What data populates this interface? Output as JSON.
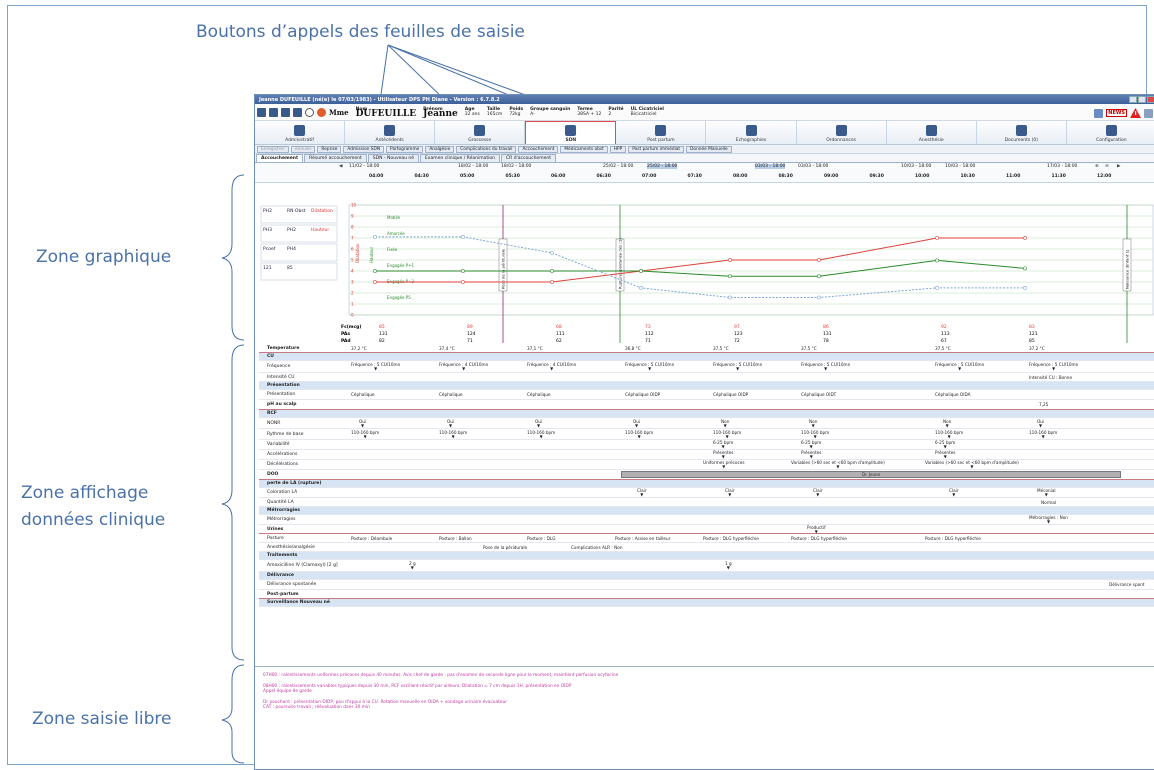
{
  "annotations": {
    "top": "Boutons d’appels des feuilles de saisie",
    "graph": "Zone graphique",
    "clinical_1": "Zone affichage",
    "clinical_2": "données clinique",
    "free": "Zone saisie libre"
  },
  "window": {
    "title": "Jeanne DUFEUILLE (né(e) le 07/03/1983) - Utilisateur DPS PH Diane - Version : 6.7.8.2"
  },
  "patient": {
    "mode_label": "Mme",
    "nom_label": "Nom",
    "nom": "DUFEUILLE",
    "prenom_label": "Prénom",
    "prenom": "Jeanne",
    "age_label": "Age",
    "age": "32 ans",
    "taille_label": "Taille",
    "taille": "165cm",
    "poids_label": "Poids",
    "poids": "72kg",
    "groupe_label": "Groupe sanguin",
    "groupe": "A-",
    "terme_label": "Terme",
    "terme": "38SA + 12",
    "parite_label": "Parité",
    "parite": "2",
    "ul_label": "UL Cicatriciel",
    "ul": "Bicicatriciel",
    "news_badge": "NEWS"
  },
  "nav_tabs": [
    {
      "label": "Administratif"
    },
    {
      "label": "Antécédents"
    },
    {
      "label": "Grossesse"
    },
    {
      "label": "SDN"
    },
    {
      "label": "Post partum"
    },
    {
      "label": "Echographies"
    },
    {
      "label": "Ordonnances"
    },
    {
      "label": "Anesthésie"
    },
    {
      "label": "Documents (0)"
    },
    {
      "label": "Configuration"
    }
  ],
  "actions": [
    "Enregistrer",
    "Annuler",
    "Reprise",
    "Admission SDN",
    "Partogramme",
    "Analgésie",
    "Complications du travail",
    "Accouchement",
    "Médicaments obst",
    "HPP",
    "Post partum immédiat",
    "Donnée Manuelle"
  ],
  "subtabs": [
    "Accouchement",
    "Résumé accouchement",
    "SDN - Nouveau né",
    "Examen clinique / Réanimation",
    "CR d'accouchement"
  ],
  "timeline": {
    "dates": [
      "11/02 - 18:00",
      "18/02 - 18:00",
      "18/02 - 18:00",
      "25/02 - 18:00",
      "25/02 - 18:00",
      "03/03 - 18:00",
      "03/03 - 18:00",
      "10/03 - 18:00",
      "10/03 - 18:00",
      "17/03 - 18:00"
    ],
    "hours": [
      "04:00",
      "04:30",
      "05:00",
      "05:30",
      "06:00",
      "06:30",
      "07:00",
      "07:30",
      "08:00",
      "08:30",
      "09:00",
      "09:30",
      "10:00",
      "10:30",
      "11:00",
      "11:30",
      "12:00"
    ]
  },
  "graph": {
    "left_boxes": [
      [
        "PH2",
        "RN Obst",
        "Dilatation"
      ],
      [
        "PH3",
        "PH2",
        "Hauteur"
      ],
      [
        "Pcoef",
        "PH4"
      ],
      [
        "121",
        "85"
      ]
    ],
    "levels": [
      "Mobile",
      "Amorcée",
      "Fixée",
      "Engagée P+1",
      "Engagée P+3",
      "Engagée P5"
    ],
    "y_axis": [
      "10",
      "9",
      "8",
      "7",
      "6",
      "5",
      "4",
      "3",
      "2",
      "1",
      "0"
    ],
    "axis_titles": [
      "Dilatation",
      "Hauteur"
    ],
    "events": [
      "Pose de la péridurale",
      "Rupture spontanée des (1)",
      "Naissance (Enfant 1)"
    ],
    "fc_label": "Fc(mcg)",
    "pas_label": "PAs",
    "pad_label": "PAd",
    "fc_values": [
      "85",
      "89",
      "68",
      "73",
      "97",
      "86",
      "92",
      "83"
    ],
    "pas_values": [
      "131",
      "124",
      "111",
      "112",
      "123",
      "131",
      "113",
      "121"
    ],
    "pad_values": [
      "82",
      "71",
      "62",
      "71",
      "72",
      "78",
      "67",
      "85"
    ]
  },
  "clinical": {
    "temperature_label": "Temperature",
    "temperature": [
      "37,2 °C",
      "37,4 °C",
      "37,1 °C",
      "36,8 °C",
      "37,5 °C",
      "37,5 °C",
      "37,5 °C",
      "37,2 °C"
    ],
    "cu_label": "CU",
    "frequence_label": "Fréquence",
    "frequence": [
      "Fréquence : 5 CU/10mn",
      "Fréquence : 4 CU/10mn",
      "Fréquence : 4 CU/10mn",
      "Fréquence : 5 CU/10mn",
      "Fréquence : 5 CU/10mn",
      "Fréquence : 5 CU/10mn",
      "Fréquence : 5 CU/10mn",
      "Fréquence : 5 CU/10mn"
    ],
    "intensite_label": "Intensité CU",
    "intensite": "Intensité CU : Bonne",
    "presentation_section": "Présentation",
    "presentation_label": "Présentation",
    "presentation": [
      "Céphalique",
      "Céphalique",
      "Céphalique",
      "Céphalique OIDP",
      "Céphalique OIDP",
      "Céphalique OIDT",
      "Céphalique OIDA"
    ],
    "ph_label": "pH au scalp",
    "ph_value": "7,25",
    "rcf_label": "RCF",
    "nonr_label": "NONR",
    "nonr": [
      "Oui",
      "Oui",
      "Oui",
      "Oui",
      "Non",
      "Non",
      "Non",
      "Oui"
    ],
    "rythme_label": "Rythme de base",
    "rythme": [
      "110-160 bpm",
      "110-160 bpm",
      "110-160 bpm",
      "110-160 bpm",
      "110-160 bpm",
      "110-160 bpm",
      "110-160 bpm",
      "110-160 bpm"
    ],
    "variabilite_label": "Variabilité",
    "variabilite": [
      "6-25 bpm",
      "6-25 bpm",
      "6-25 bpm"
    ],
    "accelerations_label": "Accélérations",
    "accelerations": [
      "Présentes",
      "Présentes",
      "Présentes"
    ],
    "decelerations_label": "Décélérations",
    "decelerations": [
      "Uniformes précoces",
      "Variables (>60 sec et <60 bpm d'amplitude)",
      "Variables (>60 sec et <60 bpm d'amplitude)"
    ],
    "doo_label": "DOO",
    "doo_bar": "Dr. Jeune",
    "perte_label": "perte de LA (rupture)",
    "coloration_label": "Coloration LA",
    "coloration": [
      "Clair",
      "Clair",
      "Clair",
      "Clair",
      "Méconial"
    ],
    "quantite_label": "Quantité LA",
    "quantite": "Normal",
    "metro_section": "Métrorragies",
    "metro_label": "Métrorragies",
    "metro": "Métrorragies : Non",
    "urines_label": "Urines",
    "urines": "Productif",
    "posture_label": "Posture",
    "posture": [
      "Posture : Déambule",
      "Posture : Ballon",
      "Posture : DLG",
      "Posture : Assise en tailleur",
      "Posture : DLG hyperfléchie",
      "Posture : DLG hyperfléchie",
      "Posture : DLG hyperfléchie"
    ],
    "anesth_label": "Anesthésie/analgésie",
    "anesth": [
      "Pose de la péridurale",
      "Complications ALR : Non"
    ],
    "traitements_label": "Traitements",
    "amox_label": "Amoxicilline IV (Clamoxyl) [2 g]",
    "amox": [
      "2 g",
      "1 g"
    ],
    "delivrance_section": "Délivrance",
    "delivrance_label": "Délivrance spontanée",
    "delivrance": "Délivrance spont",
    "postpartum_label": "Post-partum",
    "surveillance_label": "Surveillance Nouveau né"
  },
  "notes": [
    "07H00 : ralentissements uniformes précoces depuis 40 minutes. Avis chef de garde : pas d'examen de seconde ligne pour le moment, maintient perfusion ocytocine",
    "08H00 : ralentissements variables typiques depuis 30 min, RCF oscillant réactif par ailleurs. Dilatation = 7 cm depuis 1H, présentation en OIDP",
    "Appel équipe de garde",
    "Dr pouchard : présentation OIDP, peu d'appui à la CU. Rotation manuelle en OIDA + sondage urinaire évacuateur",
    "CAT : poursuite travail ; réévaluation dans 30 min"
  ]
}
